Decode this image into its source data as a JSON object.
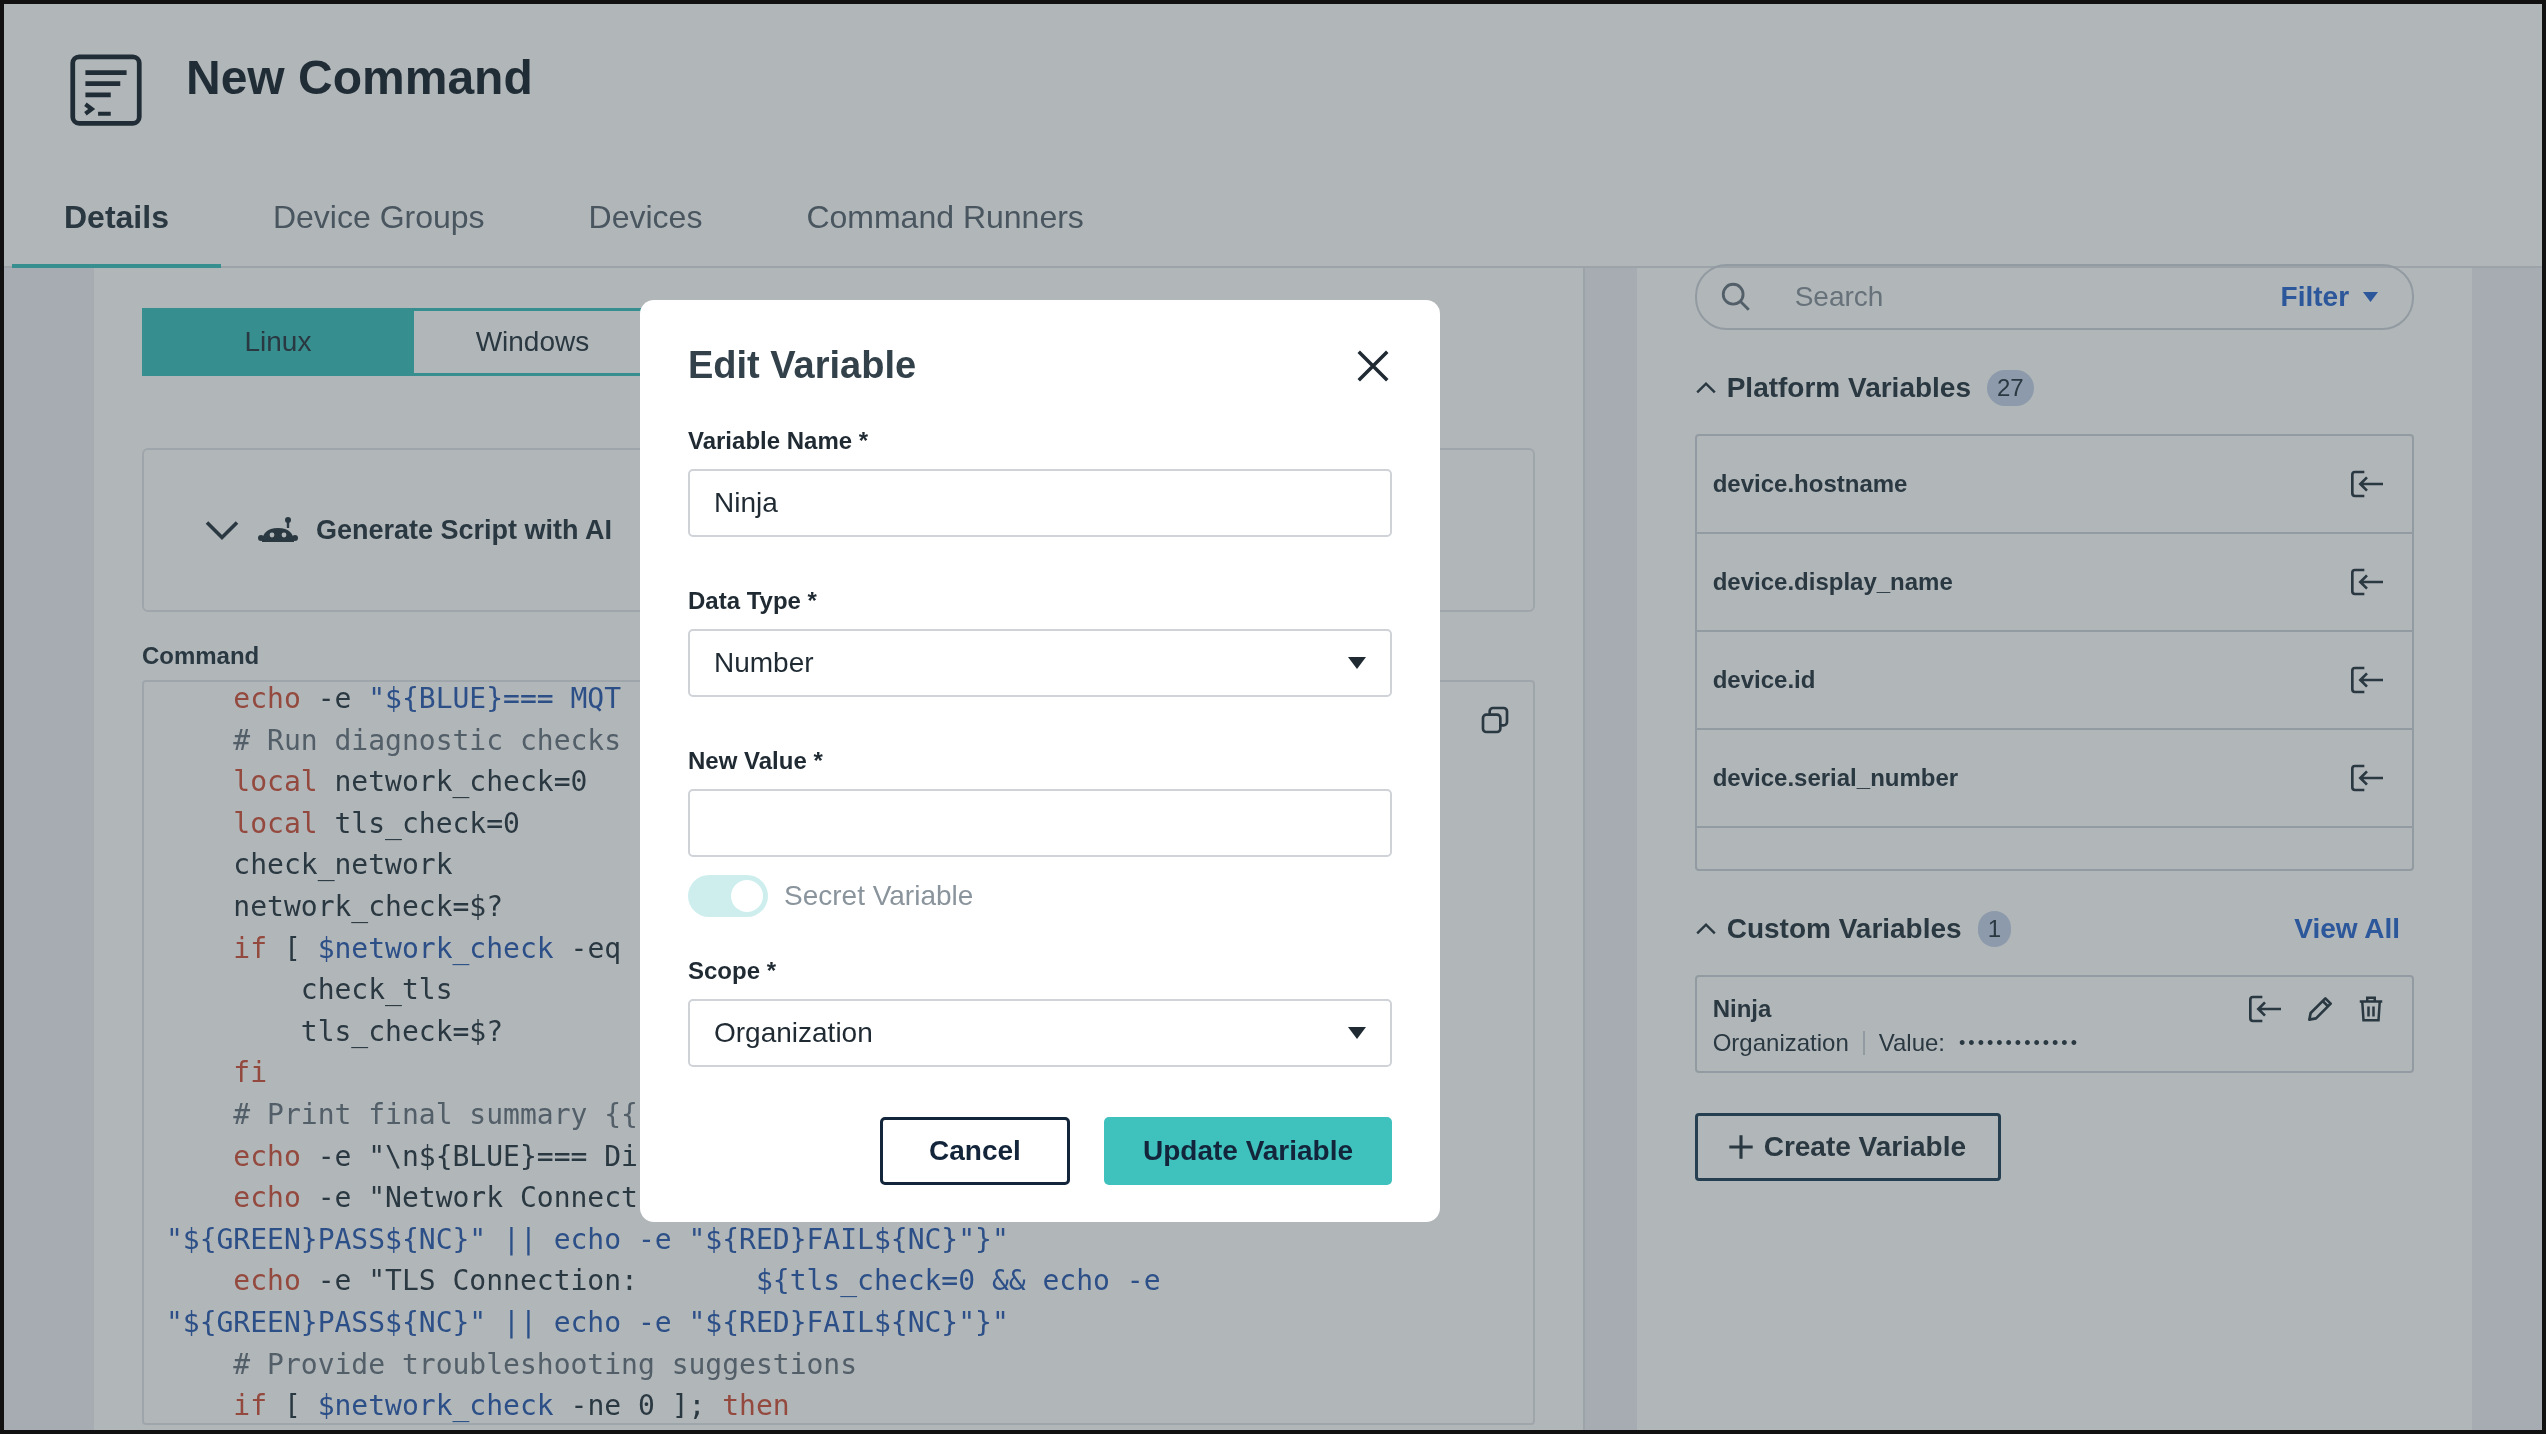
{
  "header": {
    "title": "New Command"
  },
  "tabs": [
    {
      "label": "Details",
      "selected": true
    },
    {
      "label": "Device Groups",
      "selected": false
    },
    {
      "label": "Devices",
      "selected": false
    },
    {
      "label": "Command Runners",
      "selected": false
    }
  ],
  "os_toggle": [
    {
      "label": "Linux",
      "selected": true
    },
    {
      "label": "Windows",
      "selected": false
    }
  ],
  "ai_panel": {
    "label": "Generate Script with AI",
    "expanded": false
  },
  "command": {
    "label": "Command",
    "lines": [
      [
        {
          "kind": "keyword",
          "text": "    echo"
        },
        {
          "kind": "plain",
          "text": " -e "
        },
        {
          "kind": "string",
          "text": "\"${BLUE}=== MQT"
        }
      ],
      [
        {
          "kind": "comment",
          "text": "    # Run diagnostic checks"
        }
      ],
      [
        {
          "kind": "keyword",
          "text": "    local"
        },
        {
          "kind": "plain",
          "text": " network_check=0"
        }
      ],
      [
        {
          "kind": "keyword",
          "text": "    local"
        },
        {
          "kind": "plain",
          "text": " tls_check=0"
        }
      ],
      [
        {
          "kind": "plain",
          "text": "    check_network"
        }
      ],
      [
        {
          "kind": "plain",
          "text": "    network_check=$?"
        }
      ],
      [
        {
          "kind": "keyword",
          "text": "    if"
        },
        {
          "kind": "plain",
          "text": " [ "
        },
        {
          "kind": "variable",
          "text": "$network_check"
        },
        {
          "kind": "plain",
          "text": " -eq"
        }
      ],
      [
        {
          "kind": "plain",
          "text": "        check_tls"
        }
      ],
      [
        {
          "kind": "plain",
          "text": "        tls_check=$?"
        }
      ],
      [
        {
          "kind": "keyword",
          "text": "    fi"
        }
      ],
      [
        {
          "kind": "comment",
          "text": "    # Print final summary {{"
        }
      ],
      [
        {
          "kind": "keyword",
          "text": "    echo"
        },
        {
          "kind": "plain",
          "text": " -e \"\\n${BLUE}=== Di"
        }
      ],
      [
        {
          "kind": "keyword",
          "text": "    echo"
        },
        {
          "kind": "plain",
          "text": " -e \"Network Connect"
        }
      ],
      [
        {
          "kind": "string",
          "text": "\"${GREEN}PASS${NC}\" || echo -e \"${RED}FAIL${NC}\"}\""
        }
      ],
      [
        {
          "kind": "keyword",
          "text": "    echo"
        },
        {
          "kind": "plain",
          "text": " -e \"TLS Connection:       "
        },
        {
          "kind": "string",
          "text": "${tls_check=0 && echo -e"
        }
      ],
      [
        {
          "kind": "string",
          "text": "\"${GREEN}PASS${NC}\" || echo -e \"${RED}FAIL${NC}\"}\""
        }
      ],
      [
        {
          "kind": "comment",
          "text": "    # Provide troubleshooting suggestions"
        }
      ],
      [
        {
          "kind": "keyword",
          "text": "    if"
        },
        {
          "kind": "plain",
          "text": " [ "
        },
        {
          "kind": "variable",
          "text": "$network_check"
        },
        {
          "kind": "plain",
          "text": " -ne 0 ]; "
        },
        {
          "kind": "keyword",
          "text": "then"
        }
      ]
    ]
  },
  "variables_panel": {
    "search": {
      "placeholder": "Search"
    },
    "filter": "Filter",
    "platform": {
      "title": "Platform Variables",
      "count": "27",
      "expanded": true,
      "items": [
        "device.hostname",
        "device.display_name",
        "device.id",
        "device.serial_number"
      ]
    },
    "custom": {
      "title": "Custom Variables",
      "count": "1",
      "expanded": true,
      "view_all": "View All",
      "items": [
        {
          "name": "Ninja",
          "scope": "Organization",
          "value_label": "Value:",
          "value": "•••••••••••••"
        }
      ]
    },
    "create_button": "Create Variable"
  },
  "dialog": {
    "title": "Edit Variable",
    "fields": [
      {
        "kind": "text",
        "label": "Variable Name *",
        "value": "Ninja"
      },
      {
        "kind": "select",
        "label": "Data Type *",
        "value": "Number"
      },
      {
        "kind": "text",
        "label": "New Value *"
      },
      {
        "kind": "toggle",
        "label": "Secret Variable",
        "on": true,
        "disabled": true
      },
      {
        "kind": "select",
        "label": "Scope *",
        "value": "Organization"
      }
    ],
    "buttons": [
      {
        "kind": "secondary",
        "label": "Cancel"
      },
      {
        "kind": "primary",
        "label": "Update Variable"
      }
    ]
  }
}
